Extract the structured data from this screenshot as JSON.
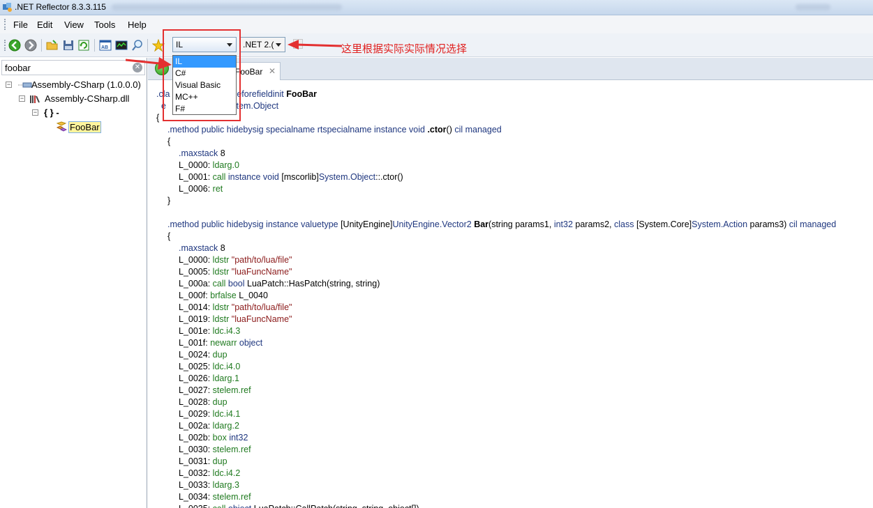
{
  "window": {
    "title": ".NET Reflector 8.3.3.115"
  },
  "menu": [
    "File",
    "Edit",
    "View",
    "Tools",
    "Help"
  ],
  "toolbar": {
    "language_selected": "IL",
    "framework_selected": ".NET 2.(",
    "icons": [
      "back-icon",
      "forward-icon",
      "open-icon",
      "save-icon",
      "refresh-icon",
      "assembly-list-icon",
      "analyzer-icon",
      "search-icon",
      "bookmark-icon"
    ]
  },
  "language_options": [
    "IL",
    "C#",
    "Visual Basic",
    "MC++",
    "F#"
  ],
  "annotation": {
    "text": "这里根据实际实际情况选择",
    "color": "#e33030"
  },
  "search": {
    "value": "foobar"
  },
  "tree": [
    {
      "label": "Assembly-CSharp (1.0.0.0)",
      "expander": "⊟"
    },
    {
      "label": "Assembly-CSharp.dll",
      "expander": "⊟"
    },
    {
      "label": "{ } -",
      "expander": "⊟"
    },
    {
      "label": "FooBar",
      "expander": ""
    }
  ],
  "tab": {
    "label": "FooBar"
  },
  "code_lines": [
    {
      "indent": 0,
      "segs": [
        {
          "c": "kw",
          "t": ".cla"
        },
        {
          "c": "",
          "t": "                    "
        },
        {
          "c": "kw",
          "t": "nsi beforefieldinit "
        },
        {
          "c": "bd",
          "t": "FooBar"
        }
      ]
    },
    {
      "indent": 0,
      "segs": [
        {
          "c": "kw",
          "t": "  e"
        },
        {
          "c": "",
          "t": "                    "
        },
        {
          "c": "kw",
          "t": "b]System.Object"
        }
      ]
    },
    {
      "indent": 0,
      "segs": [
        {
          "c": "",
          "t": "{"
        }
      ]
    },
    {
      "indent": 1,
      "segs": [
        {
          "c": "kw",
          "t": ".method public hidebysig specialname rtspecialname instance void "
        },
        {
          "c": "bd",
          "t": ".ctor"
        },
        {
          "c": "",
          "t": "() "
        },
        {
          "c": "kw",
          "t": "cil managed"
        }
      ]
    },
    {
      "indent": 1,
      "segs": [
        {
          "c": "",
          "t": "{"
        }
      ]
    },
    {
      "indent": 2,
      "segs": [
        {
          "c": "kw",
          "t": ".maxstack "
        },
        {
          "c": "",
          "t": "8"
        }
      ]
    },
    {
      "indent": 2,
      "segs": [
        {
          "c": "",
          "t": "L_0000: "
        },
        {
          "c": "gr",
          "t": "ldarg.0"
        }
      ]
    },
    {
      "indent": 2,
      "segs": [
        {
          "c": "",
          "t": "L_0001: "
        },
        {
          "c": "gr",
          "t": "call "
        },
        {
          "c": "kw",
          "t": "instance void "
        },
        {
          "c": "",
          "t": "[mscorlib]"
        },
        {
          "c": "kw",
          "t": "System.Object"
        },
        {
          "c": "",
          "t": "::.ctor()"
        }
      ]
    },
    {
      "indent": 2,
      "segs": [
        {
          "c": "",
          "t": "L_0006: "
        },
        {
          "c": "gr",
          "t": "ret"
        }
      ]
    },
    {
      "indent": 1,
      "segs": [
        {
          "c": "",
          "t": "}"
        }
      ]
    },
    {
      "indent": 0,
      "segs": [
        {
          "c": "",
          "t": " "
        }
      ]
    },
    {
      "indent": 1,
      "segs": [
        {
          "c": "kw",
          "t": ".method public hidebysig instance valuetype "
        },
        {
          "c": "",
          "t": "[UnityEngine]"
        },
        {
          "c": "kw",
          "t": "UnityEngine.Vector2 "
        },
        {
          "c": "bd",
          "t": "Bar"
        },
        {
          "c": "",
          "t": "(string params1, "
        },
        {
          "c": "kw",
          "t": "int32 "
        },
        {
          "c": "",
          "t": "params2, "
        },
        {
          "c": "kw",
          "t": "class "
        },
        {
          "c": "",
          "t": "[System.Core]"
        },
        {
          "c": "kw",
          "t": "System.Action "
        },
        {
          "c": "",
          "t": "params3) "
        },
        {
          "c": "kw",
          "t": "cil managed"
        }
      ]
    },
    {
      "indent": 1,
      "segs": [
        {
          "c": "",
          "t": "{"
        }
      ]
    },
    {
      "indent": 2,
      "segs": [
        {
          "c": "kw",
          "t": ".maxstack "
        },
        {
          "c": "",
          "t": "8"
        }
      ]
    },
    {
      "indent": 2,
      "segs": [
        {
          "c": "",
          "t": "L_0000: "
        },
        {
          "c": "gr",
          "t": "ldstr "
        },
        {
          "c": "st",
          "t": "\"path/to/lua/file\""
        }
      ]
    },
    {
      "indent": 2,
      "segs": [
        {
          "c": "",
          "t": "L_0005: "
        },
        {
          "c": "gr",
          "t": "ldstr "
        },
        {
          "c": "st",
          "t": "\"luaFuncName\""
        }
      ]
    },
    {
      "indent": 2,
      "segs": [
        {
          "c": "",
          "t": "L_000a: "
        },
        {
          "c": "gr",
          "t": "call "
        },
        {
          "c": "kw",
          "t": "bool "
        },
        {
          "c": "",
          "t": "LuaPatch::HasPatch(string, string)"
        }
      ]
    },
    {
      "indent": 2,
      "segs": [
        {
          "c": "",
          "t": "L_000f: "
        },
        {
          "c": "gr",
          "t": "brfalse "
        },
        {
          "c": "",
          "t": "L_0040"
        }
      ]
    },
    {
      "indent": 2,
      "segs": [
        {
          "c": "",
          "t": "L_0014: "
        },
        {
          "c": "gr",
          "t": "ldstr "
        },
        {
          "c": "st",
          "t": "\"path/to/lua/file\""
        }
      ]
    },
    {
      "indent": 2,
      "segs": [
        {
          "c": "",
          "t": "L_0019: "
        },
        {
          "c": "gr",
          "t": "ldstr "
        },
        {
          "c": "st",
          "t": "\"luaFuncName\""
        }
      ]
    },
    {
      "indent": 2,
      "segs": [
        {
          "c": "",
          "t": "L_001e: "
        },
        {
          "c": "gr",
          "t": "ldc.i4.3"
        }
      ]
    },
    {
      "indent": 2,
      "segs": [
        {
          "c": "",
          "t": "L_001f: "
        },
        {
          "c": "gr",
          "t": "newarr "
        },
        {
          "c": "kw",
          "t": "object"
        }
      ]
    },
    {
      "indent": 2,
      "segs": [
        {
          "c": "",
          "t": "L_0024: "
        },
        {
          "c": "gr",
          "t": "dup"
        }
      ]
    },
    {
      "indent": 2,
      "segs": [
        {
          "c": "",
          "t": "L_0025: "
        },
        {
          "c": "gr",
          "t": "ldc.i4.0"
        }
      ]
    },
    {
      "indent": 2,
      "segs": [
        {
          "c": "",
          "t": "L_0026: "
        },
        {
          "c": "gr",
          "t": "ldarg.1"
        }
      ]
    },
    {
      "indent": 2,
      "segs": [
        {
          "c": "",
          "t": "L_0027: "
        },
        {
          "c": "gr",
          "t": "stelem.ref"
        }
      ]
    },
    {
      "indent": 2,
      "segs": [
        {
          "c": "",
          "t": "L_0028: "
        },
        {
          "c": "gr",
          "t": "dup"
        }
      ]
    },
    {
      "indent": 2,
      "segs": [
        {
          "c": "",
          "t": "L_0029: "
        },
        {
          "c": "gr",
          "t": "ldc.i4.1"
        }
      ]
    },
    {
      "indent": 2,
      "segs": [
        {
          "c": "",
          "t": "L_002a: "
        },
        {
          "c": "gr",
          "t": "ldarg.2"
        }
      ]
    },
    {
      "indent": 2,
      "segs": [
        {
          "c": "",
          "t": "L_002b: "
        },
        {
          "c": "gr",
          "t": "box "
        },
        {
          "c": "kw",
          "t": "int32"
        }
      ]
    },
    {
      "indent": 2,
      "segs": [
        {
          "c": "",
          "t": "L_0030: "
        },
        {
          "c": "gr",
          "t": "stelem.ref"
        }
      ]
    },
    {
      "indent": 2,
      "segs": [
        {
          "c": "",
          "t": "L_0031: "
        },
        {
          "c": "gr",
          "t": "dup"
        }
      ]
    },
    {
      "indent": 2,
      "segs": [
        {
          "c": "",
          "t": "L_0032: "
        },
        {
          "c": "gr",
          "t": "ldc.i4.2"
        }
      ]
    },
    {
      "indent": 2,
      "segs": [
        {
          "c": "",
          "t": "L_0033: "
        },
        {
          "c": "gr",
          "t": "ldarg.3"
        }
      ]
    },
    {
      "indent": 2,
      "segs": [
        {
          "c": "",
          "t": "L_0034: "
        },
        {
          "c": "gr",
          "t": "stelem.ref"
        }
      ]
    },
    {
      "indent": 2,
      "segs": [
        {
          "c": "",
          "t": "L_0035: "
        },
        {
          "c": "gr",
          "t": "call "
        },
        {
          "c": "kw",
          "t": "object "
        },
        {
          "c": "",
          "t": "LuaPatch::CallPatch(string, string, object[])"
        }
      ]
    }
  ]
}
